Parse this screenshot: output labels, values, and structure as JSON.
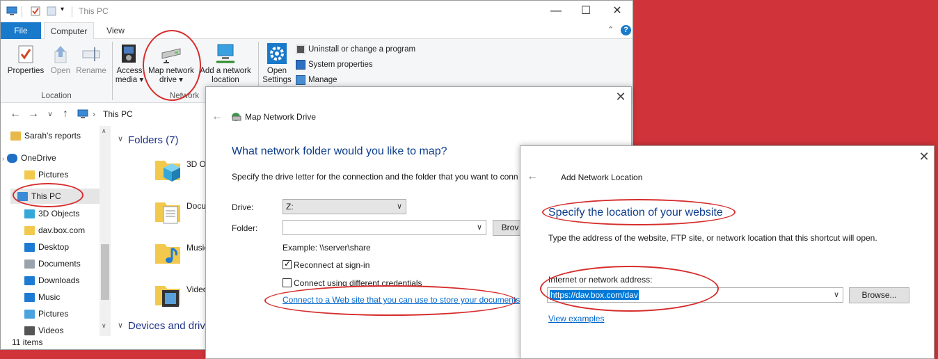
{
  "explorer": {
    "title": "This PC",
    "tabs": {
      "file": "File",
      "computer": "Computer",
      "view": "View"
    },
    "ribbon": {
      "properties": "Properties",
      "open": "Open",
      "rename": "Rename",
      "access_media_1": "Access",
      "access_media_2": "media",
      "map_drive_1": "Map network",
      "map_drive_2": "drive",
      "add_location_1": "Add a network",
      "add_location_2": "location",
      "open_settings_1": "Open",
      "open_settings_2": "Settings",
      "uninstall": "Uninstall or change a program",
      "system_properties": "System properties",
      "manage": "Manage",
      "group_location": "Location",
      "group_network": "Network"
    },
    "address": {
      "path": "This PC"
    },
    "nav": {
      "items": [
        {
          "label": "Sarah's reports",
          "icon_color": "#e8b84a"
        },
        {
          "label": "OneDrive",
          "icon_color": "#1f6fc5"
        },
        {
          "label": "Pictures",
          "icon_color": "#f2c94c"
        },
        {
          "label": "This PC",
          "icon_color": "#3a8ad6"
        },
        {
          "label": "3D Objects",
          "icon_color": "#35a7d8"
        },
        {
          "label": "dav.box.com",
          "icon_color": "#f2c94c"
        },
        {
          "label": "Desktop",
          "icon_color": "#1e7bd4"
        },
        {
          "label": "Documents",
          "icon_color": "#9aa3ad"
        },
        {
          "label": "Downloads",
          "icon_color": "#1e7bd4"
        },
        {
          "label": "Music",
          "icon_color": "#1e7bd4"
        },
        {
          "label": "Pictures",
          "icon_color": "#4aa3df"
        },
        {
          "label": "Videos",
          "icon_color": "#555"
        }
      ]
    },
    "content": {
      "folders_header": "Folders (7)",
      "devices_header": "Devices and drive",
      "folders": [
        "3D Ol",
        "Docu",
        "Music",
        "Video"
      ]
    },
    "status": "11 items"
  },
  "map_drive": {
    "title": "Map Network Drive",
    "heading": "What network folder would you like to map?",
    "description": "Specify the drive letter for the connection and the folder that you want to conn",
    "drive_label": "Drive:",
    "drive_value": "Z:",
    "folder_label": "Folder:",
    "folder_value": "",
    "browse": "Brov",
    "example": "Example: \\\\server\\share",
    "reconnect": "Reconnect at sign-in",
    "different_credentials": "Connect using different credentials",
    "web_link": "Connect to a Web site that you can use to store your documents"
  },
  "add_location": {
    "title": "Add Network Location",
    "heading": "Specify the location of your website",
    "description": "Type the address of the website, FTP site, or network location that this shortcut will open.",
    "address_label": "Internet or network address:",
    "address_value": "https://dav.box.com/dav",
    "browse": "Browse...",
    "examples_link": "View examples"
  },
  "colors": {
    "desktop_bg": "#d0343a",
    "accent_blue": "#1979ca",
    "heading_blue": "#0b3c8c",
    "link_blue": "#0066cc",
    "annotation_red": "#d62d2d"
  }
}
